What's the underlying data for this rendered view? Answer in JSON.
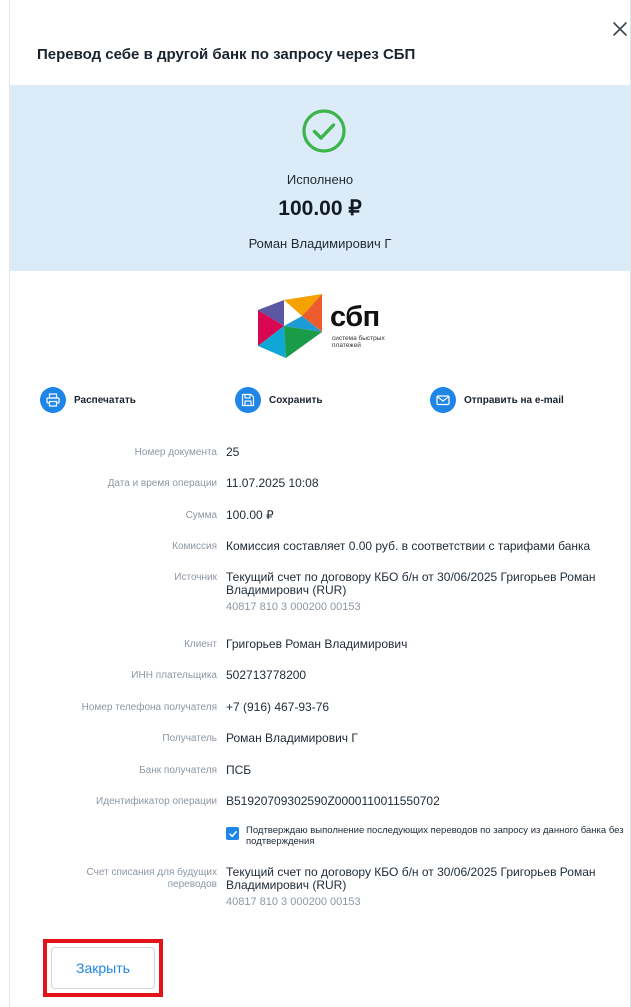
{
  "modal": {
    "title": "Перевод себе в другой банк по запросу через СБП",
    "close_symbol": "×"
  },
  "status": {
    "text": "Исполнено",
    "amount": "100.00 ₽",
    "recipient_short": "Роман Владимирович Г"
  },
  "logo": {
    "word": "сбп",
    "subtitle_line1": "система быстрых",
    "subtitle_line2": "платежей"
  },
  "actions": {
    "print": "Распечатать",
    "save": "Сохранить",
    "email": "Отправить на e-mail"
  },
  "details": [
    {
      "label": "Номер документа",
      "value": "25"
    },
    {
      "label": "Дата и время операции",
      "value": "11.07.2025 10:08"
    },
    {
      "label": "Сумма",
      "value": "100.00 ₽"
    },
    {
      "label": "Комиссия",
      "value": "Комиссия составляет 0.00 руб. в соответствии с тарифами банка"
    },
    {
      "label": "Источник",
      "value": "Текущий счет по договору КБО б/н от 30/06/2025 Григорьев Роман Владимирович (RUR)",
      "account": "40817 810 3 000200 00153"
    },
    {
      "label": "Клиент",
      "value": "Григорьев Роман Владимирович"
    },
    {
      "label": "ИНН плательщика",
      "value": "502713778200"
    },
    {
      "label": "Номер телефона получателя",
      "value": "+7 (916) 467-93-76"
    },
    {
      "label": "Получатель",
      "value": "Роман Владимирович Г"
    },
    {
      "label": "Банк получателя",
      "value": "ПСБ"
    },
    {
      "label": "Идентификатор операции",
      "value": "B51920709302590Z0000110011550702"
    }
  ],
  "confirm": {
    "checked": true,
    "label": "Подтверждаю выполнение последующих переводов по запросу из данного банка без подтверждения"
  },
  "future_account": {
    "label": "Счет списания для будущих переводов",
    "value": "Текущий счет по договору КБО б/н от 30/06/2025 Григорьев Роман Владимирович (RUR)",
    "account": "40817 810 3 000200 00153"
  },
  "buttons": {
    "close": "Закрыть"
  },
  "colors": {
    "accent": "#1f86e8",
    "banner": "#dcebf8",
    "success": "#3bb54a",
    "highlight": "#e3131b"
  }
}
